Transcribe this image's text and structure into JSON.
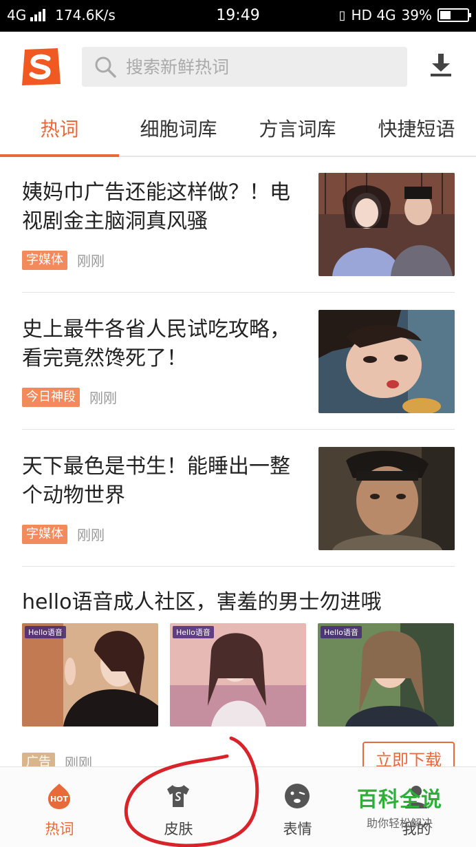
{
  "status_bar": {
    "network": "4G",
    "speed": "174.6K/s",
    "time": "19:49",
    "right_network": "HD 4G",
    "battery": "39%",
    "battery_level": 0.39
  },
  "search": {
    "placeholder": "搜索新鲜热词"
  },
  "tabs": [
    {
      "label": "热词",
      "active": true
    },
    {
      "label": "细胞词库"
    },
    {
      "label": "方言词库"
    },
    {
      "label": "快捷短语"
    }
  ],
  "feed": [
    {
      "title": "姨妈巾广告还能这样做？！电视剧金主脑洞真风骚",
      "tag": "字媒体",
      "time": "刚刚"
    },
    {
      "title": "史上最牛各省人民试吃攻略，看完竟然馋死了！",
      "tag": "今日神段",
      "time": "刚刚"
    },
    {
      "title": "天下最色是书生！能睡出一整个动物世界",
      "tag": "字媒体",
      "time": "刚刚"
    }
  ],
  "ad": {
    "title": "hello语音成人社区，害羞的男士勿进哦",
    "badge": "Hello语音",
    "tag": "广告",
    "time": "刚刚",
    "button": "立即下载"
  },
  "bottom_nav": [
    {
      "label": "热词",
      "icon": "hot-icon",
      "active": true,
      "icon_text": "HOT"
    },
    {
      "label": "皮肤",
      "icon": "skin-shirt-icon"
    },
    {
      "label": "表情",
      "icon": "emoji-icon"
    },
    {
      "label": "我的",
      "icon": "user-icon"
    }
  ],
  "watermark": {
    "main": "百科全说",
    "sub": "助你轻松解决"
  },
  "colors": {
    "accent": "#e8693a",
    "tag": "#f38a5c",
    "watermark": "#2fae3a",
    "annotation": "#d9232a"
  }
}
